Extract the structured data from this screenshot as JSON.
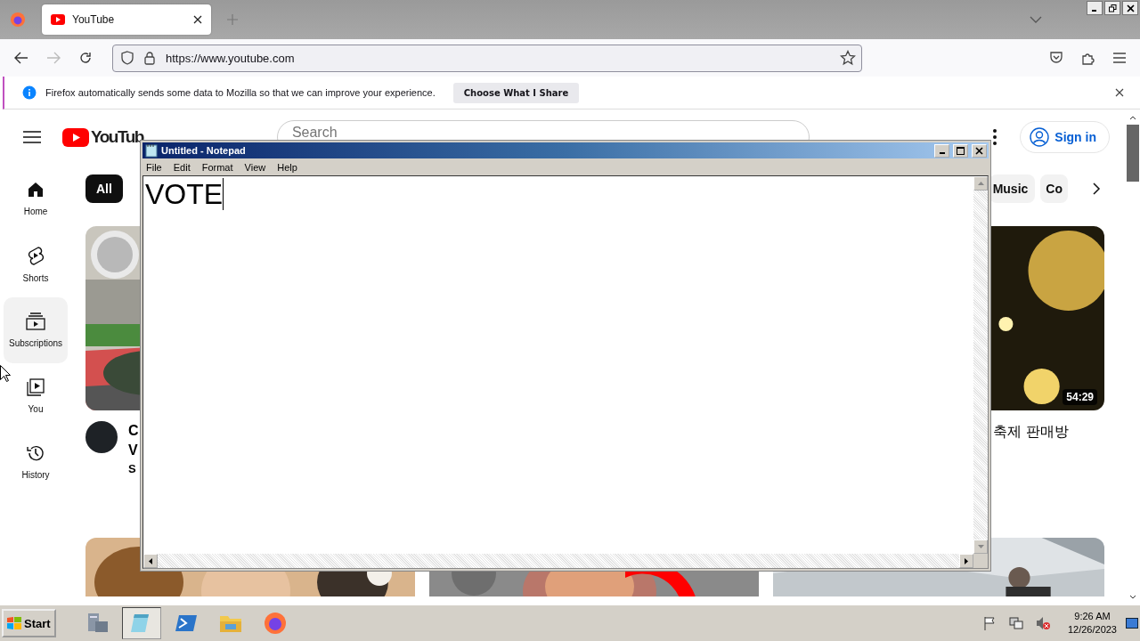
{
  "browser": {
    "tabs": [
      {
        "title": "YouTube",
        "selected": true
      }
    ],
    "url": "https://www.youtube.com",
    "notification": {
      "text": "Firefox automatically sends some data to Mozilla so that we can improve your experience.",
      "button": "Choose What I Share"
    }
  },
  "youtube": {
    "logo": "YouTub",
    "search": {
      "placeholder": "Search"
    },
    "sign_in": "Sign in",
    "sidebar": [
      {
        "label": "Home",
        "kind": "home",
        "selected": false
      },
      {
        "label": "Shorts",
        "kind": "shorts",
        "selected": false
      },
      {
        "label": "Subscriptions",
        "kind": "subscriptions",
        "selected": true
      },
      {
        "label": "You",
        "kind": "you",
        "selected": false
      },
      {
        "label": "History",
        "kind": "history",
        "selected": false
      }
    ],
    "chips": [
      {
        "label": "All",
        "selected": true
      },
      {
        "label": "Music",
        "selected": false
      },
      {
        "label": "Co",
        "selected": false
      }
    ],
    "videos": [
      {
        "title_lines": [
          "C",
          "V"
        ],
        "channel": "S"
      },
      {
        "duration": "54:29",
        "title": "축제 판매방"
      }
    ]
  },
  "notepad": {
    "title": "Untitled - Notepad",
    "menu": [
      "File",
      "Edit",
      "Format",
      "View",
      "Help"
    ],
    "text": "VOTE"
  },
  "taskbar": {
    "start": "Start",
    "time": "9:26 AM",
    "date": "12/26/2023"
  }
}
